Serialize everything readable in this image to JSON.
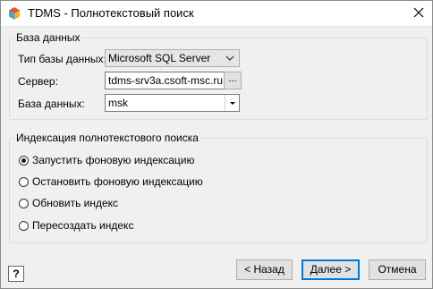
{
  "window": {
    "title": "TDMS - Полнотекстовый поиск",
    "icons": {
      "app": "tdms-app-icon",
      "close": "close-icon"
    }
  },
  "database_group": {
    "title": "База данных",
    "db_type": {
      "label": "Тип базы данных:",
      "value": "Microsoft SQL Server"
    },
    "server": {
      "label": "Сервер:",
      "value": "tdms-srv3a.csoft-msc.ru",
      "browse_label": "..."
    },
    "database": {
      "label": "База данных:",
      "value": "msk"
    }
  },
  "indexing_group": {
    "title": "Индексация полнотекстового поиска",
    "options": [
      {
        "label": "Запустить фоновую индексацию",
        "checked": true
      },
      {
        "label": "Остановить фоновую индексацию",
        "checked": false
      },
      {
        "label": "Обновить индекс",
        "checked": false
      },
      {
        "label": "Пересоздать индекс",
        "checked": false
      }
    ]
  },
  "footer": {
    "help_label": "?",
    "back_label": "< Назад",
    "next_label": "Далее >",
    "cancel_label": "Отмена"
  }
}
